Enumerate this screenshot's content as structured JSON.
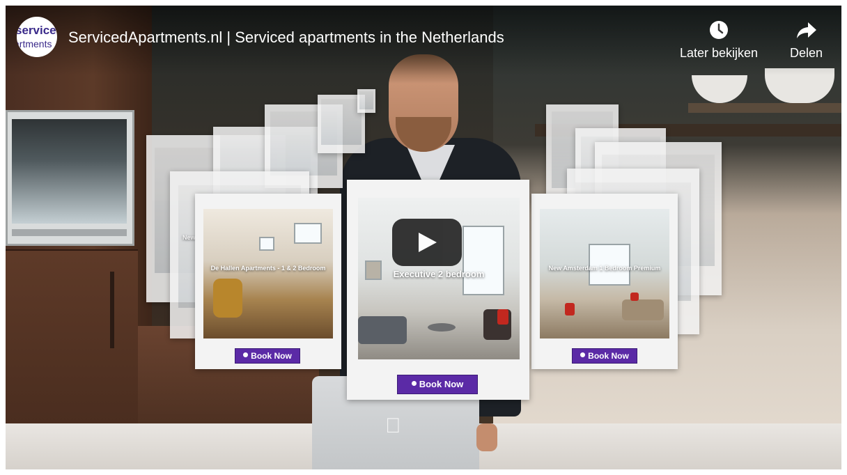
{
  "video": {
    "title": "ServicedApartments.nl | Serviced apartments in the Netherlands",
    "channel_logo_line1": "serviced",
    "channel_logo_line2": "artments"
  },
  "actions": {
    "watch_later": "Later bekijken",
    "share": "Delen"
  },
  "cards": {
    "left_caption": "De Hallen Apartments - 1 & 2 Bedroom",
    "center_caption": "Executive 2 bedroom",
    "right_caption": "New Amsterdam 1 Bedroom Premium",
    "ghost_caption": "New",
    "book_label": "Book Now"
  },
  "colors": {
    "book_button": "#5b2aa6",
    "play_button": "#212121"
  }
}
